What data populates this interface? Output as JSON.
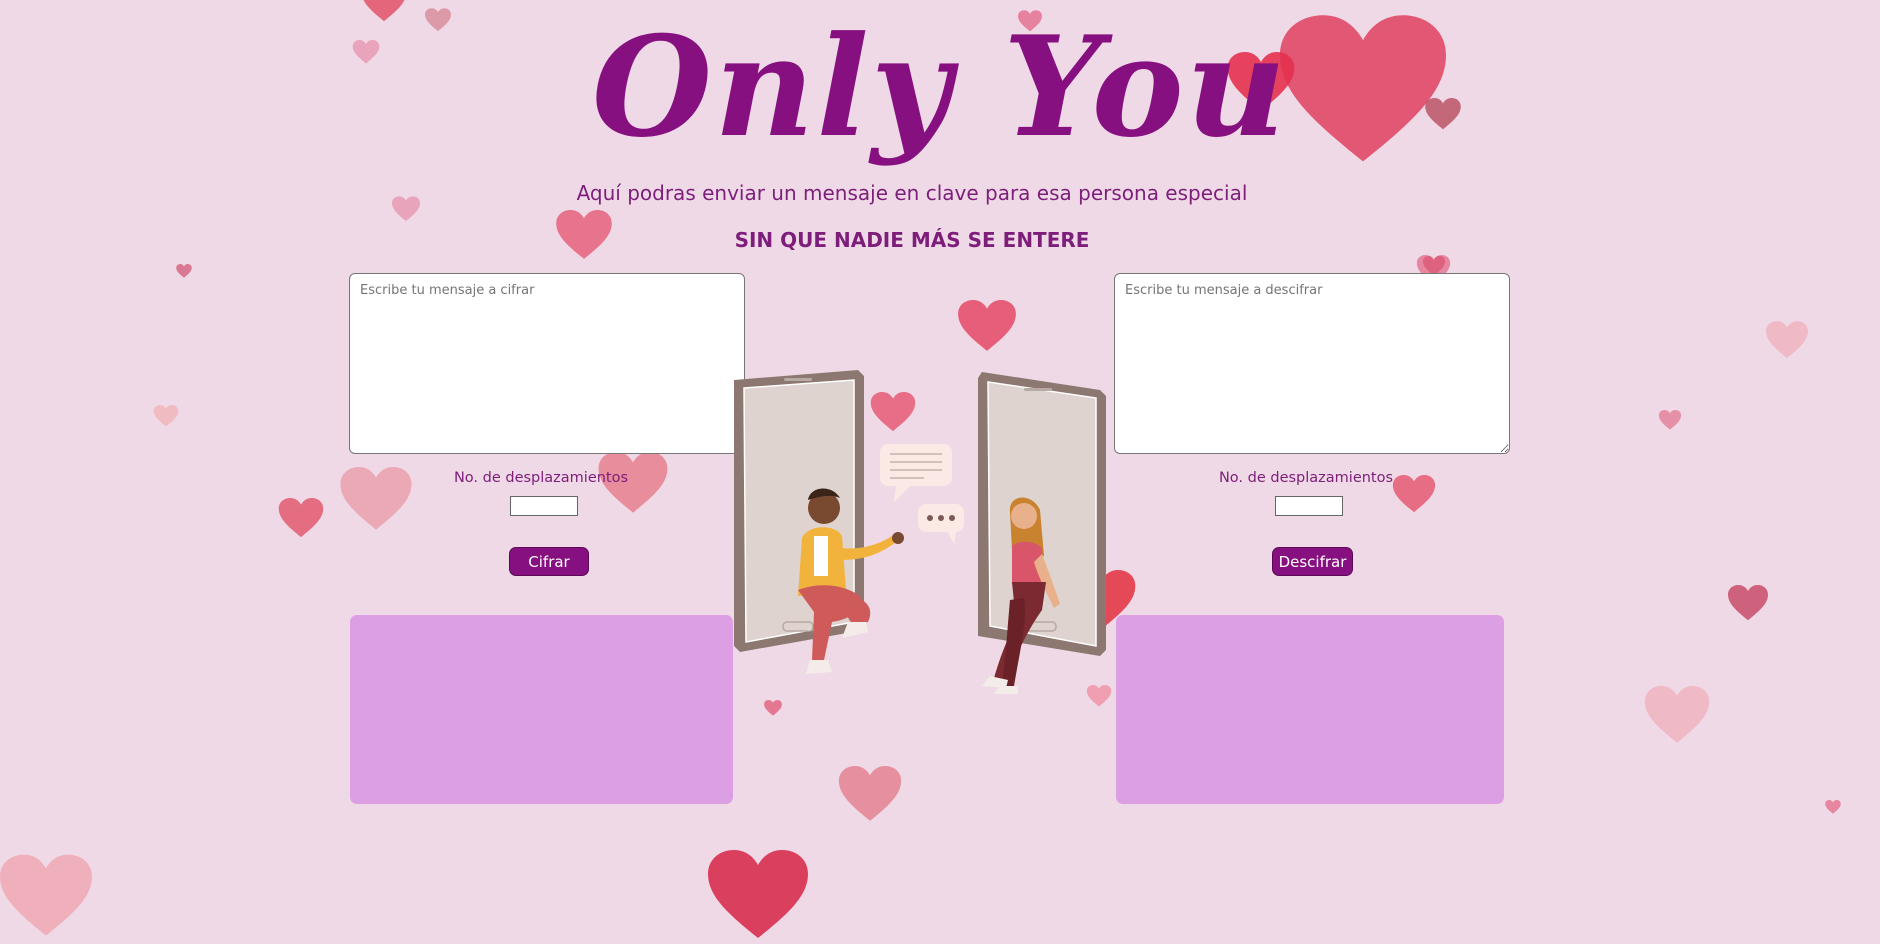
{
  "header": {
    "title": "Only You",
    "subtitle": "Aquí podras enviar un mensaje en clave para esa persona especial",
    "tagline": "SIN QUE NADIE MÁS SE ENTERE"
  },
  "encrypt": {
    "placeholder": "Escribe tu mensaje a cifrar",
    "shift_label": "No. de desplazamientos",
    "shift_value": "",
    "button_label": "Cifrar",
    "output": ""
  },
  "decrypt": {
    "placeholder": "Escribe tu mensaje a descifrar",
    "shift_label": "No. de desplazamientos",
    "shift_value": "",
    "button_label": "Descifrar",
    "output": ""
  },
  "colors": {
    "background": "#f0d9e6",
    "title": "#86107f",
    "text": "#7c1e7a",
    "button": "#86107f",
    "output_box": "#dc9fe4",
    "heart": "#e0415f"
  },
  "decorations": {
    "background_icon": "heart-icon",
    "illustration": "couple-chatting-phones-illustration"
  }
}
